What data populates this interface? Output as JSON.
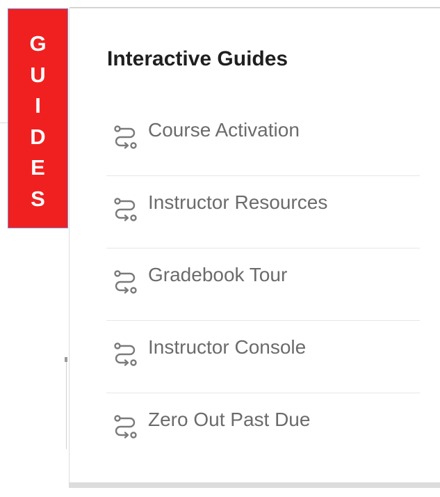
{
  "tab": {
    "letters": [
      "G",
      "U",
      "I",
      "D",
      "E",
      "S"
    ],
    "color": "#f02020",
    "text_color": "#ffffff"
  },
  "panel": {
    "title": "Interactive Guides",
    "items": [
      {
        "label": "Course Activation",
        "icon": "route-icon"
      },
      {
        "label": "Instructor Resources",
        "icon": "route-icon"
      },
      {
        "label": "Gradebook Tour",
        "icon": "route-icon"
      },
      {
        "label": "Instructor Console",
        "icon": "route-icon"
      },
      {
        "label": "Zero Out Past Due",
        "icon": "route-icon"
      }
    ]
  }
}
